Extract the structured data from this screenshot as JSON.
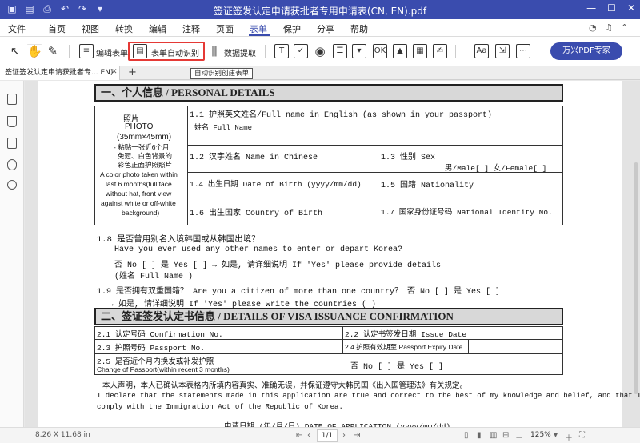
{
  "window": {
    "title": "签证签发认定申请获批者专用申请表(CN, EN).pdf"
  },
  "menu": [
    "文件",
    "首页",
    "视图",
    "转换",
    "编辑",
    "注释",
    "页面",
    "表单",
    "保护",
    "分享",
    "帮助"
  ],
  "toolbar": {
    "edit_form_label": "编辑表单",
    "auto_recognize_label": "表单自动识别",
    "data_extract_label": "数据提取",
    "premium_label": "万兴PDF专家",
    "tooltip": "自动识别创建表单"
  },
  "tab": {
    "label": "签证签发认定申请获批者专... EN)"
  },
  "form": {
    "section1": "一、个人信息 / PERSONAL DETAILS",
    "photo": [
      "照片",
      "PHOTO",
      "(35mm×45mm)",
      "- 粘贴一张近6个月",
      "免冠、白色背景的",
      "彩色正面护照照片",
      "A color photo taken within",
      "last 6 months(full face",
      "without hat, front view",
      "against white or off-white",
      "background)"
    ],
    "f11": "1.1 护照英文姓名/Full name in English (as shown in your passport)",
    "f11_sub": "姓名 Full Name",
    "f12": "1.2 汉字姓名 Name in Chinese",
    "f13": "1.3 性别 Sex",
    "f13_opts": "男/Male[  ]  女/Female[  ]",
    "f14": "1.4 出生日期 Date of Birth (yyyy/mm/dd)",
    "f15": "1.5 国籍 Nationality",
    "f16": "1.6 出生国家 Country of Birth",
    "f17": "1.7 国家身份证号码 National Identity No.",
    "q18": "1.8 是否曾用别名入境韩国或从韩国出境？",
    "q18_en": "Have you ever used any other names to enter or depart Korea?",
    "q18_ans": "否 No [  ]   是 Yes [  ]  → 如是, 请详细说明 If 'Yes' please provide details",
    "q18_name": "(姓名 Full Name                                                )",
    "q19": "1.9 是否拥有双重国籍？ Are you a citizen of more than one country？  否 No [  ]   是 Yes [  ]",
    "q19_ans": "→ 如是, 请详细说明 If 'Yes' please write the countries  (                                    )",
    "section2": "二、签证签发认定书信息 / DETAILS OF VISA ISSUANCE CONFIRMATION",
    "f21": "2.1 认定号码 Confirmation No.",
    "f22": "2.2 认定书签发日期 Issue Date",
    "f23": "2.3 护照号码 Passport No.",
    "f24": "2.4 护照有效期至 Passport Expiry Date",
    "f25": "2.5 是否近个月内换发或补发护照",
    "f25_en": "Change of Passport(within recent 3 months)",
    "f25_ans": "否 No [  ]     是 Yes [  ]",
    "decl_cn": "本人声明，本人已确认本表格内所填内容真实、准确无误，并保证遵守大韩民国《出入国管理法》有关规定。",
    "decl_en1": "I declare that the statements made in this application are true and correct to the best of my knowledge and belief, and that I will",
    "decl_en2": "comply with the Immigration Act of the Republic of Korea.",
    "apply_date": "申请日期 (年/月/日) DATE OF APPLICATION (yyyy/mm/dd)"
  },
  "status": {
    "dimensions": "8.26 X 11.68 in",
    "page": "1/1",
    "zoom": "125%"
  }
}
